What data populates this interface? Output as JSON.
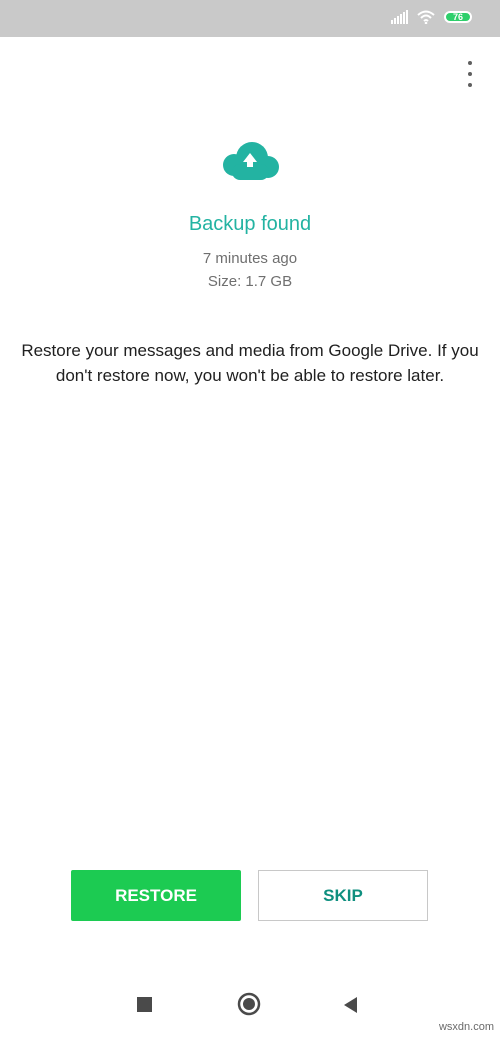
{
  "status_bar": {
    "battery_level": "76",
    "icons": [
      "signal-icon",
      "wifi-icon",
      "battery-icon"
    ]
  },
  "header": {
    "menu_icon": "more-vert-icon"
  },
  "backup": {
    "icon": "cloud-upload-icon",
    "title": "Backup found",
    "time_ago": "7 minutes ago",
    "size": "Size: 1.7 GB"
  },
  "message": "Restore your messages and media from Google Drive. If you don't restore now, you won't be able to restore later.",
  "actions": {
    "restore_label": "RESTORE",
    "skip_label": "SKIP"
  },
  "nav_bar": {
    "icons": [
      "recents-icon",
      "home-icon",
      "back-icon"
    ]
  },
  "watermark": "wsxdn.com",
  "colors": {
    "accent_teal": "#23b3a2",
    "restore_green": "#1ccb52",
    "skip_text": "#0f8f7f",
    "status_bar_bg": "#c9c9c9"
  }
}
